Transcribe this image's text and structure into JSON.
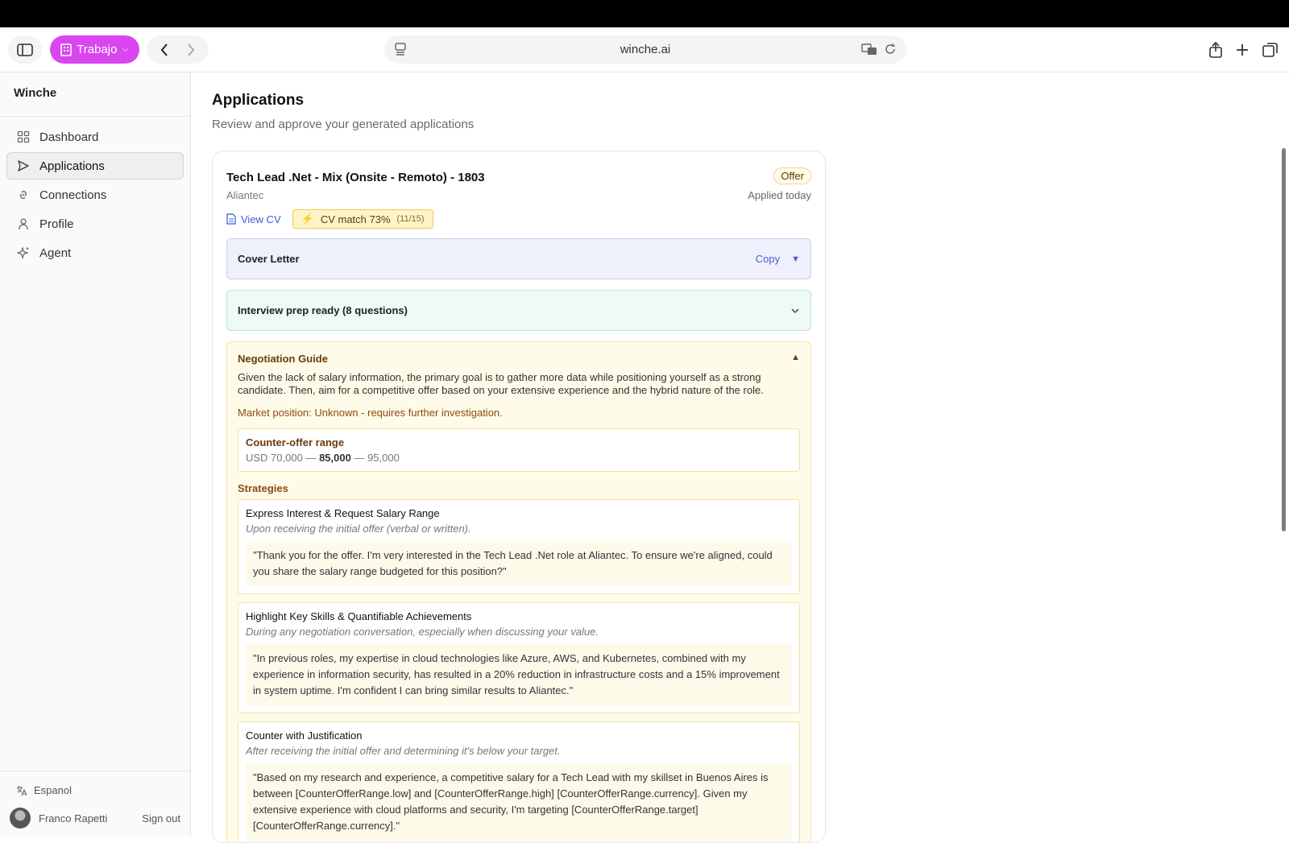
{
  "browser": {
    "profile_label": "Trabajo",
    "url": "winche.ai"
  },
  "sidebar": {
    "brand": "Winche",
    "items": [
      {
        "label": "Dashboard",
        "icon": "grid-icon"
      },
      {
        "label": "Applications",
        "icon": "send-icon"
      },
      {
        "label": "Connections",
        "icon": "link-icon"
      },
      {
        "label": "Profile",
        "icon": "user-icon"
      },
      {
        "label": "Agent",
        "icon": "sparkle-icon"
      }
    ],
    "language": "Espanol",
    "user_name": "Franco Rapetti",
    "signout": "Sign out"
  },
  "main": {
    "title": "Applications",
    "subtitle": "Review and approve your generated applications"
  },
  "application": {
    "job_title": "Tech Lead .Net - Mix (Onsite - Remoto) - 1803",
    "company": "Aliantec",
    "status": "Offer",
    "applied": "Applied today",
    "view_cv": "View CV",
    "cv_match": "CV match 73%",
    "cv_match_count": "(11/15)",
    "cover_letter": "Cover Letter",
    "copy": "Copy",
    "interview_prep": "Interview prep ready (8 questions)",
    "negotiation": {
      "title": "Negotiation Guide",
      "summary": "Given the lack of salary information, the primary goal is to gather more data while positioning yourself as a strong candidate. Then, aim for a competitive offer based on your extensive experience and the hybrid nature of the role.",
      "market": "Market position: Unknown - requires further investigation.",
      "range_title": "Counter-offer range",
      "range_low": "USD 70,000 —",
      "range_target": "85,000",
      "range_high": "— 95,000",
      "strategies_label": "Strategies",
      "strategies": [
        {
          "title": "Express Interest & Request Salary Range",
          "when": "Upon receiving the initial offer (verbal or written).",
          "quote": "\"Thank you for the offer. I'm very interested in the Tech Lead .Net role at Aliantec. To ensure we're aligned, could you share the salary range budgeted for this position?\""
        },
        {
          "title": "Highlight Key Skills & Quantifiable Achievements",
          "when": "During any negotiation conversation, especially when discussing your value.",
          "quote": "\"In previous roles, my expertise in cloud technologies like Azure, AWS, and Kubernetes, combined with my experience in information security, has resulted in a 20% reduction in infrastructure costs and a 15% improvement in system uptime. I'm confident I can bring similar results to Aliantec.\""
        },
        {
          "title": "Counter with Justification",
          "when": "After receiving the initial offer and determining it's below your target.",
          "quote": "\"Based on my research and experience, a competitive salary for a Tech Lead with my skillset in Buenos Aires is between [CounterOfferRange.low] and [CounterOfferRange.high] [CounterOfferRange.currency]. Given my extensive experience with cloud platforms and security, I'm targeting [CounterOfferRange.target] [CounterOfferRange.currency].\""
        }
      ]
    }
  }
}
